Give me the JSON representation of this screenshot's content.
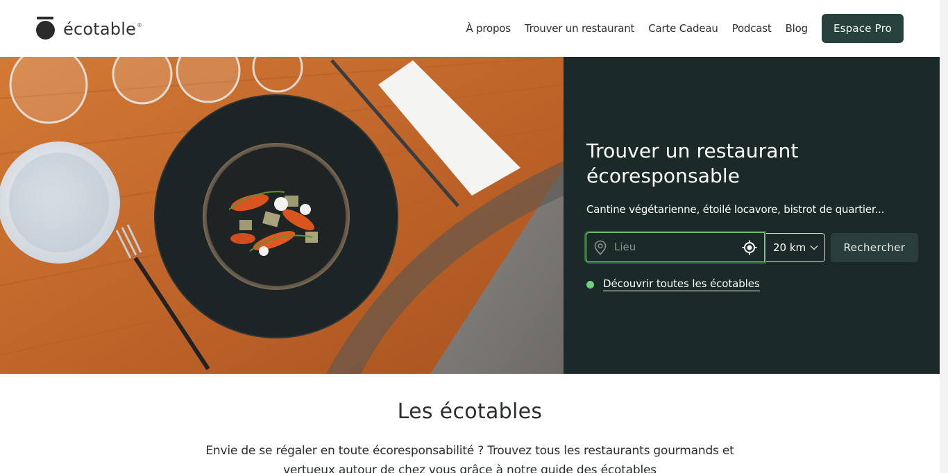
{
  "brand": {
    "name": "écotable",
    "registered": "®"
  },
  "nav": {
    "items": [
      {
        "label": "À propos"
      },
      {
        "label": "Trouver un restaurant"
      },
      {
        "label": "Carte Cadeau"
      },
      {
        "label": "Podcast"
      },
      {
        "label": "Blog"
      }
    ],
    "pro_button": "Espace Pro"
  },
  "hero": {
    "title": "Trouver un restaurant écoresponsable",
    "subtitle": "Cantine végétarienne, étoilé locavore, bistrot de quartier...",
    "search": {
      "placeholder": "Lieu",
      "value": "",
      "distance": "20 km",
      "button": "Rechercher"
    },
    "discover_link": "Découvrir toutes les écotables"
  },
  "section": {
    "title": "Les écotables",
    "text": "Envie de se régaler en toute écoresponsabilité ? Trouvez tous les restaurants gourmands et vertueux autour de chez vous grâce à notre guide des écotables"
  },
  "colors": {
    "brand_dark": "#27413c",
    "panel_bg": "#1b2a29",
    "accent_green": "#6fd17e",
    "focus_border": "#7fd07c"
  },
  "icons": {
    "pin": "map-pin-icon",
    "locate": "crosshair-icon",
    "chevron": "chevron-down-icon"
  }
}
